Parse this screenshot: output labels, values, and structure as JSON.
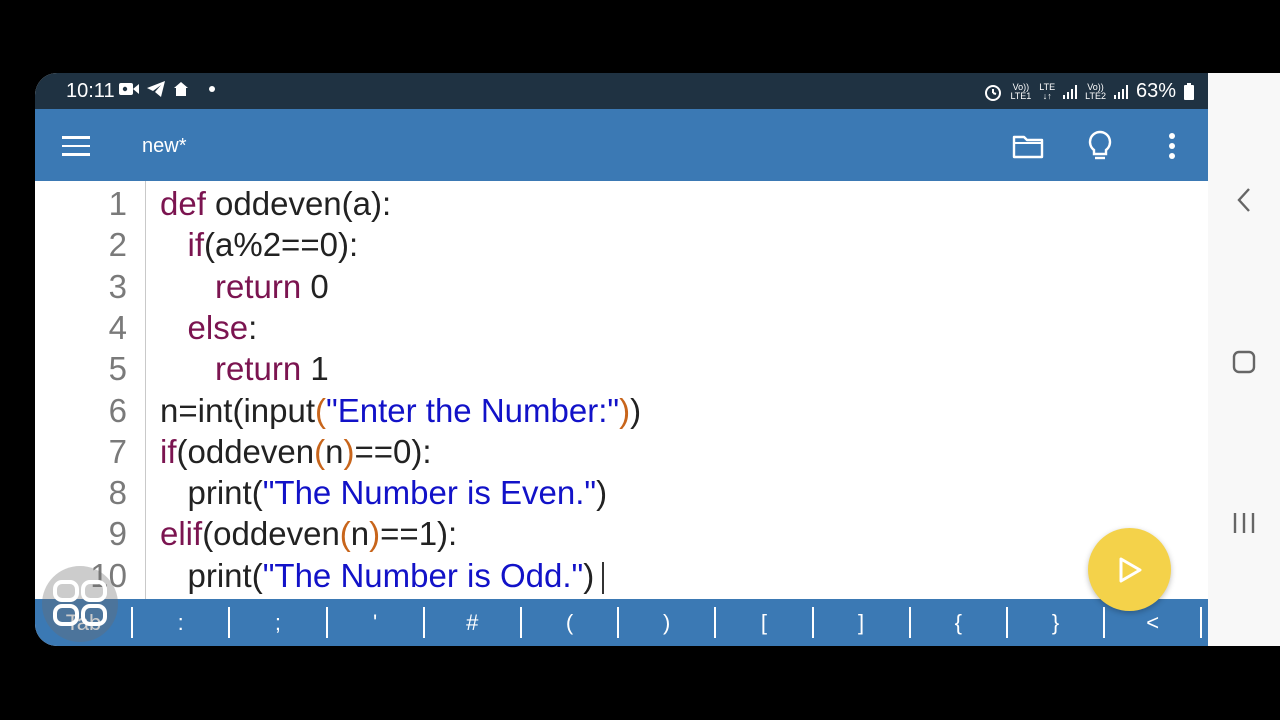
{
  "status_bar": {
    "time": "10:11",
    "battery": "63%",
    "sim1": {
      "top": "Vo))",
      "bottom": "LTE1"
    },
    "sim2": {
      "top": "Vo))",
      "bottom": "LTE2"
    },
    "lte_label": "LTE"
  },
  "app_bar": {
    "title": "new*",
    "icons": [
      "menu-icon",
      "folder-icon",
      "lightbulb-icon",
      "more-vert-icon"
    ]
  },
  "editor": {
    "lines": [
      {
        "n": "1",
        "code": [
          {
            "t": "def",
            "c": "kw"
          },
          {
            "t": " oddeven(a):",
            "c": ""
          }
        ]
      },
      {
        "n": "2",
        "code": [
          {
            "t": "   ",
            "c": ""
          },
          {
            "t": "if",
            "c": "kw"
          },
          {
            "t": "(a%2==0):",
            "c": ""
          }
        ]
      },
      {
        "n": "3",
        "code": [
          {
            "t": "      ",
            "c": ""
          },
          {
            "t": "return",
            "c": "kw"
          },
          {
            "t": " 0",
            "c": ""
          }
        ]
      },
      {
        "n": "4",
        "code": [
          {
            "t": "   ",
            "c": ""
          },
          {
            "t": "else",
            "c": "kw"
          },
          {
            "t": ":",
            "c": ""
          }
        ]
      },
      {
        "n": "5",
        "code": [
          {
            "t": "      ",
            "c": ""
          },
          {
            "t": "return",
            "c": "kw"
          },
          {
            "t": " 1",
            "c": ""
          }
        ]
      },
      {
        "n": "6",
        "code": [
          {
            "t": "n=int(input",
            "c": ""
          },
          {
            "t": "(",
            "c": "par"
          },
          {
            "t": "\"Enter the Number:\"",
            "c": "str"
          },
          {
            "t": ")",
            "c": "par"
          },
          {
            "t": ")",
            "c": ""
          }
        ]
      },
      {
        "n": "7",
        "code": [
          {
            "t": "if",
            "c": "kw"
          },
          {
            "t": "(oddeven",
            "c": ""
          },
          {
            "t": "(",
            "c": "par"
          },
          {
            "t": "n",
            "c": ""
          },
          {
            "t": ")",
            "c": "par"
          },
          {
            "t": "==0):",
            "c": ""
          }
        ]
      },
      {
        "n": "8",
        "code": [
          {
            "t": "   print(",
            "c": ""
          },
          {
            "t": "\"The Number is Even.\"",
            "c": "str"
          },
          {
            "t": ")",
            "c": ""
          }
        ]
      },
      {
        "n": "9",
        "code": [
          {
            "t": "elif",
            "c": "kw"
          },
          {
            "t": "(oddeven",
            "c": ""
          },
          {
            "t": "(",
            "c": "par"
          },
          {
            "t": "n",
            "c": ""
          },
          {
            "t": ")",
            "c": "par"
          },
          {
            "t": "==1):",
            "c": ""
          }
        ]
      },
      {
        "n": "10",
        "code": [
          {
            "t": "   print(",
            "c": ""
          },
          {
            "t": "\"The Number is Odd.\"",
            "c": "str"
          },
          {
            "t": ")",
            "c": ""
          }
        ]
      }
    ]
  },
  "keybar": {
    "keys": [
      "Tab",
      ":",
      ";",
      "'",
      "#",
      "(",
      ")",
      "[",
      "]",
      "{",
      "}",
      "<"
    ]
  },
  "run_button": {
    "icon": "play-icon"
  },
  "nav": {
    "icons": [
      "back-icon",
      "home-icon",
      "recents-icon"
    ]
  },
  "colors": {
    "app_bar": "#3b79b4",
    "status_bar": "#1f3242",
    "keyword": "#7b1450",
    "string": "#1212c8",
    "paren": "#c8651b",
    "fab": "#f4d24a"
  }
}
